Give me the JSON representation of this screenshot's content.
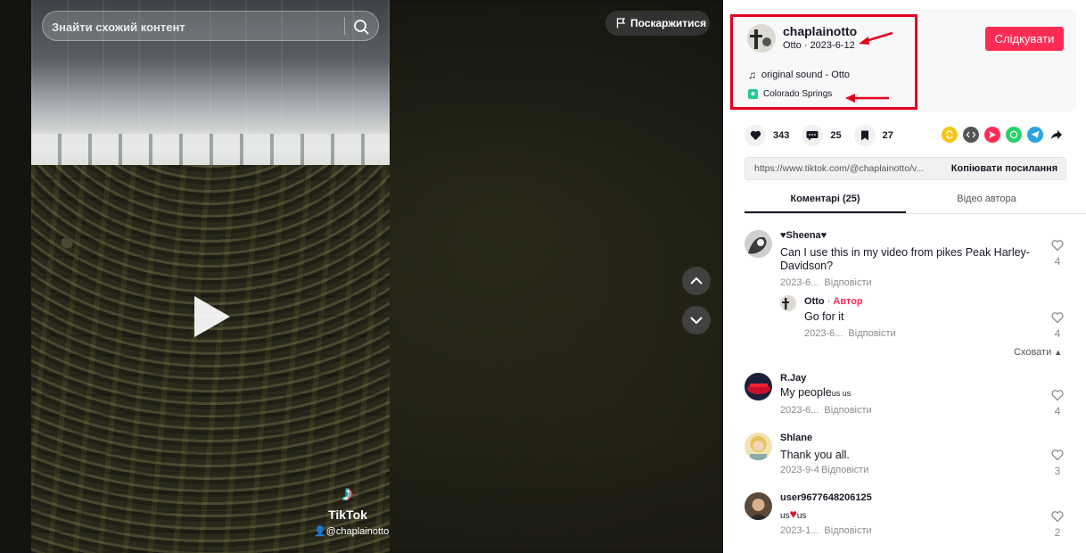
{
  "search": {
    "placeholder": "Знайти схожий контент"
  },
  "report": {
    "label": "Поскаржитися"
  },
  "video": {
    "watermark_logo": "TikTok",
    "watermark_user": "@chaplainotto"
  },
  "author": {
    "username": "chaplainotto",
    "subtitle": "Otto · 2023-6-12",
    "sound": "original sound - Otto",
    "location": "Colorado Springs",
    "follow_label": "Слідкувати"
  },
  "stats": {
    "likes": "343",
    "comments": "25",
    "saves": "27"
  },
  "link": {
    "url": "https://www.tiktok.com/@chaplainotto/v...",
    "copy_label": "Копіювати посилання"
  },
  "tabs": {
    "comments": "Коментарі (25)",
    "author_videos": "Відео автора"
  },
  "comments": [
    {
      "name": "Sheena",
      "text": "Can I use this in my video from pikes Peak Harley-Davidson?",
      "date": "2023-6...",
      "reply": "Відповісти",
      "likes": "4"
    },
    {
      "name": "Otto",
      "author_badge": "Автор",
      "text": "Go for it",
      "date": "2023-6...",
      "reply": "Відповісти",
      "likes": "4"
    },
    {
      "name": "R.Jay",
      "text": "My people",
      "text_suffix": "us us",
      "date": "2023-6...",
      "reply": "Відповісти",
      "likes": "4"
    },
    {
      "name": "Shlane",
      "text": "Thank you all.",
      "date": "2023-9-4",
      "reply": "Відповісти",
      "likes": "3"
    },
    {
      "name": "user9677648206125",
      "text_pre": "us",
      "text_post": "us",
      "date": "2023-1...",
      "reply": "Відповісти",
      "likes": "2"
    }
  ],
  "hide_replies": "Сховати",
  "colors": {
    "accent": "#fe2c55",
    "annotation": "#e3001b",
    "location": "#20c997"
  }
}
